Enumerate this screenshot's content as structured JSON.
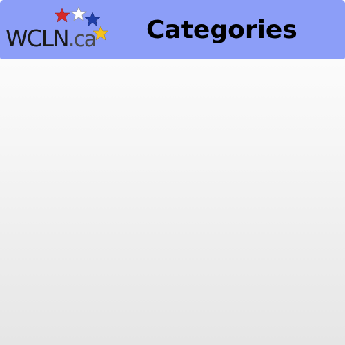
{
  "header": {
    "logo": {
      "text_main": "WCLN",
      "text_suffix": ".ca",
      "stars": [
        {
          "color": "#d62828"
        },
        {
          "color": "#ffffff"
        },
        {
          "color": "#1f3fa8"
        },
        {
          "color": "#f6c21c"
        }
      ]
    },
    "title": "Categories"
  },
  "colors": {
    "header_bg": "#8c9ef8"
  }
}
